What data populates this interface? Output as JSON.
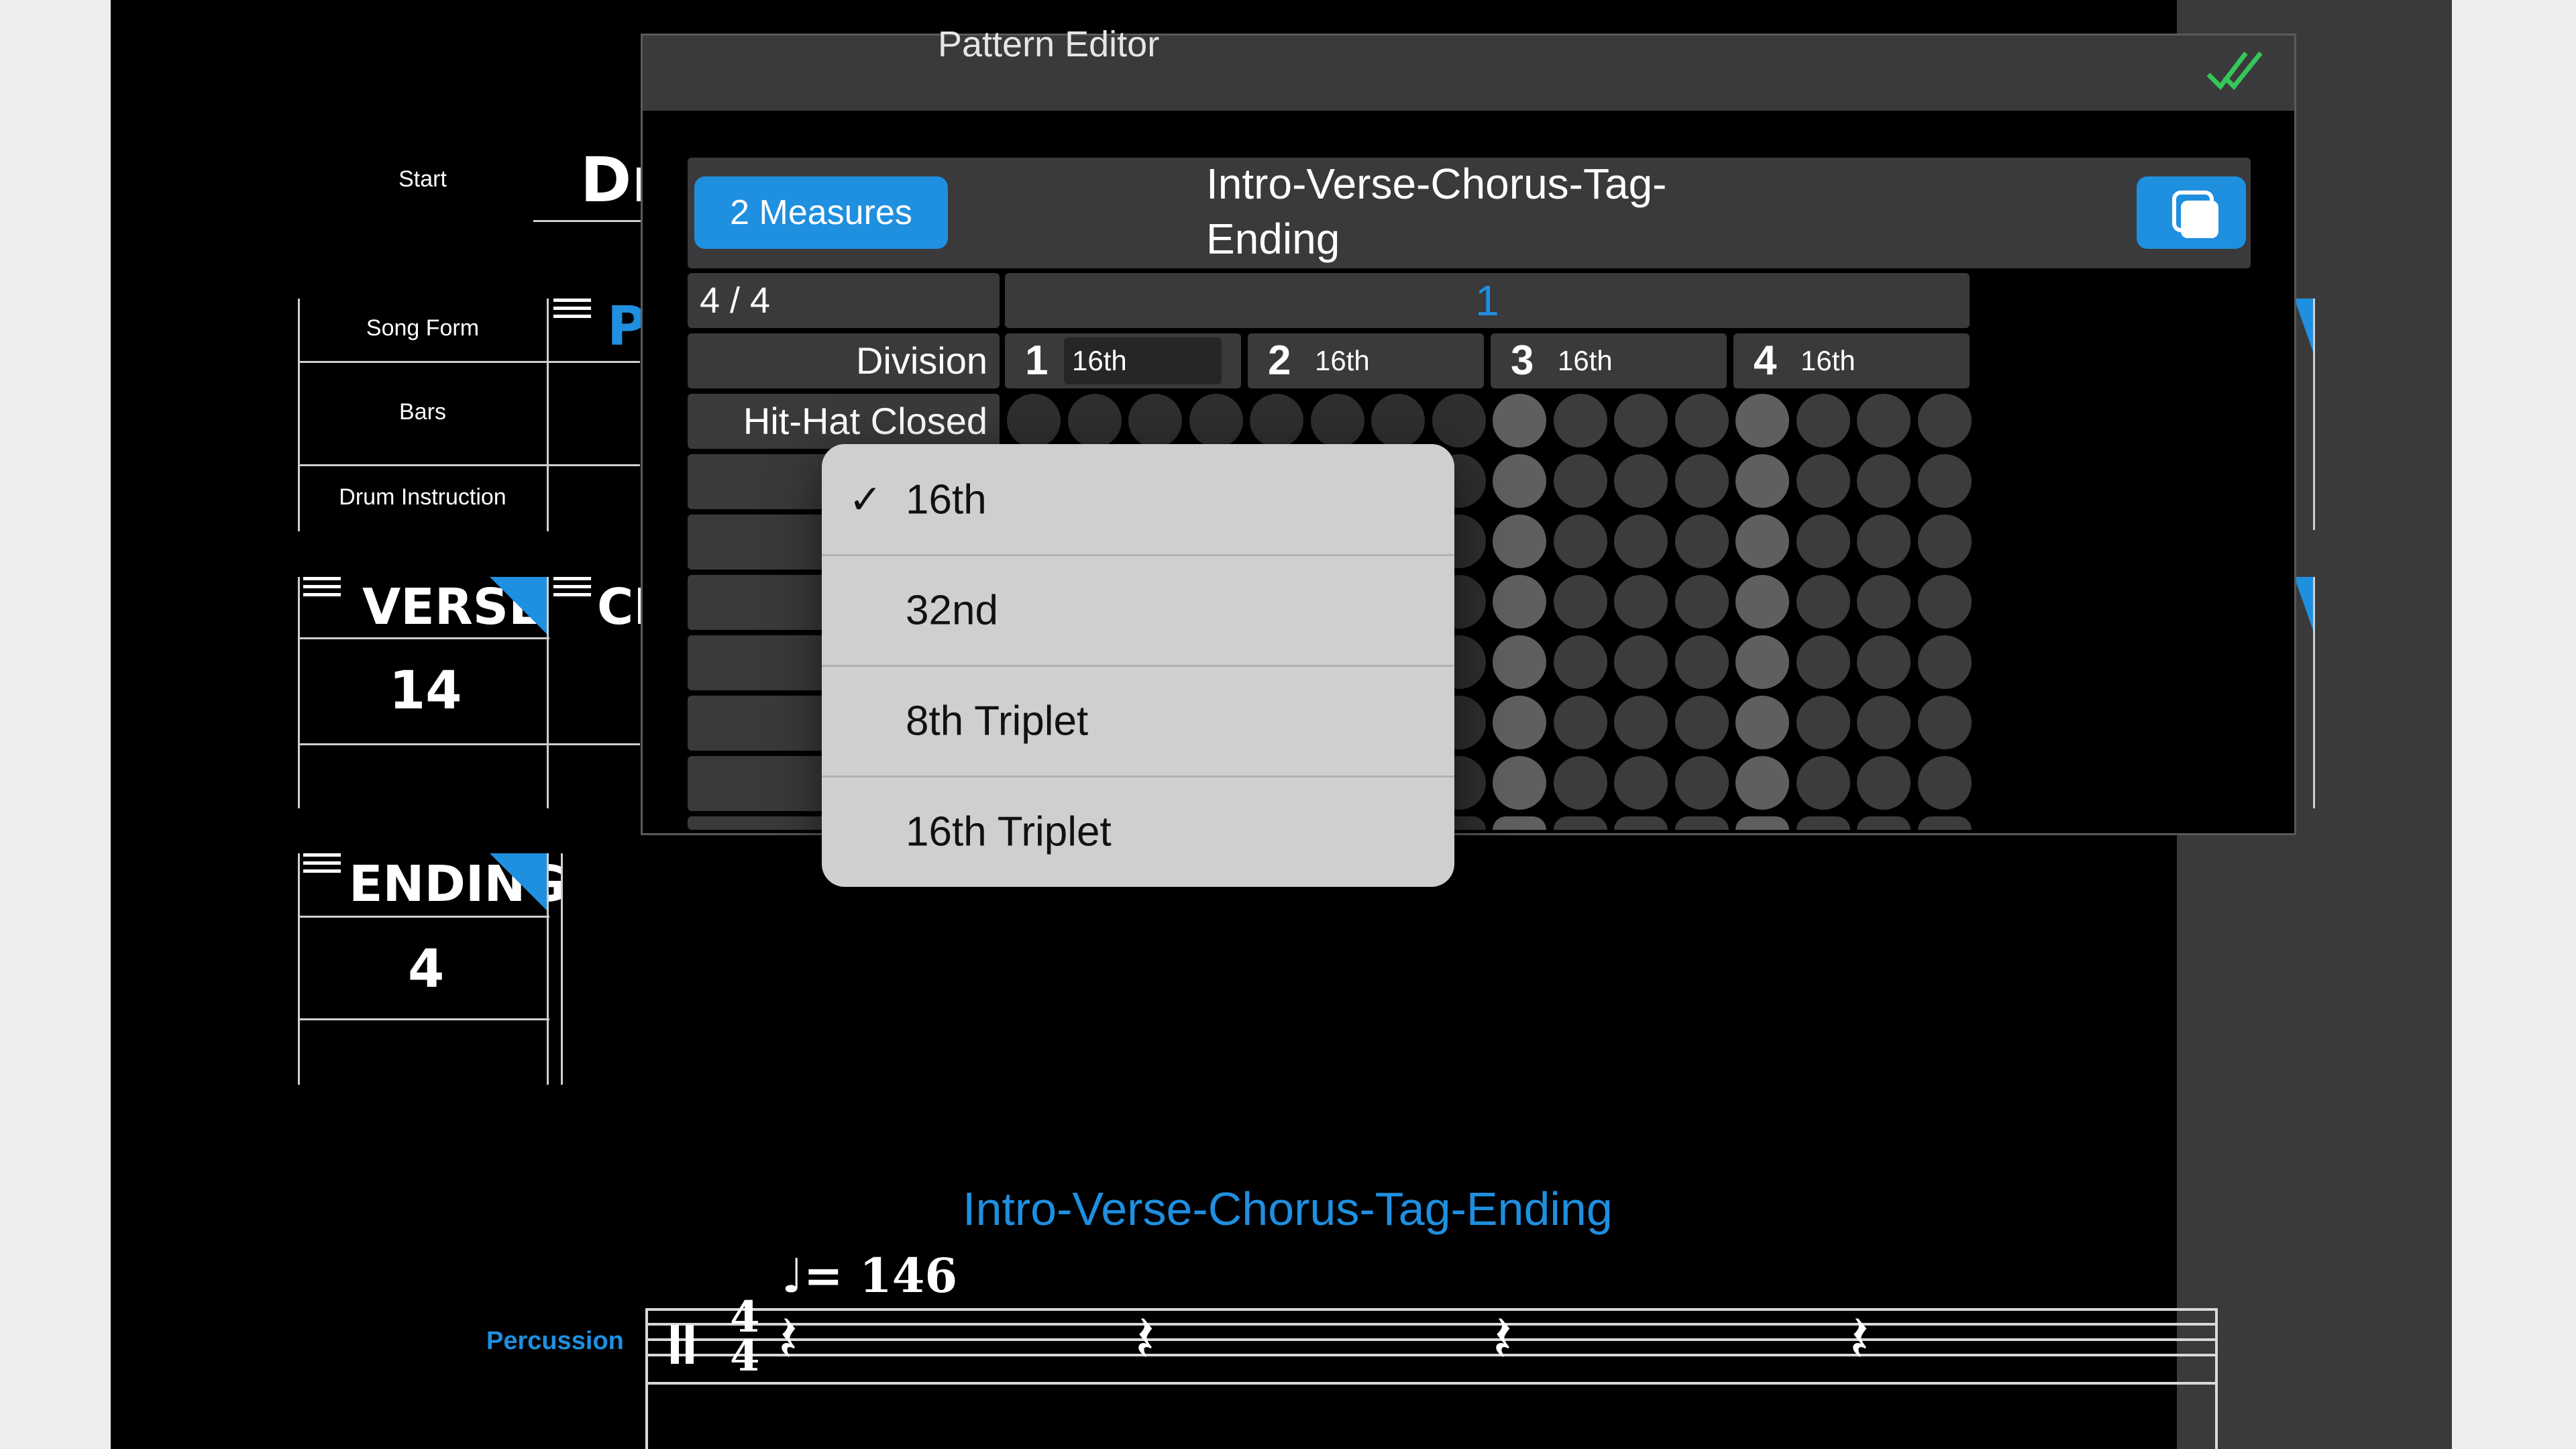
{
  "editor": {
    "title": "Pattern Editor",
    "measures_button": "2 Measures",
    "pattern_name_line1": "Intro-Verse-Chorus-Tag-",
    "pattern_name_line2": "Ending",
    "time_signature": "4 / 4",
    "measure_number": "1",
    "division_label": "Division",
    "beats": [
      {
        "num": "1",
        "division": "16th"
      },
      {
        "num": "2",
        "division": "16th"
      },
      {
        "num": "3",
        "division": "16th"
      },
      {
        "num": "4",
        "division": "16th"
      }
    ],
    "instrument_rows": [
      "Hit-Hat Closed",
      "",
      "",
      "",
      "Hit-",
      "",
      ""
    ]
  },
  "dropdown": {
    "options": [
      {
        "label": "16th",
        "checked": true
      },
      {
        "label": "32nd",
        "checked": false
      },
      {
        "label": "8th Triplet",
        "checked": false
      },
      {
        "label": "16th Triplet",
        "checked": false
      }
    ],
    "check_glyph": "✓"
  },
  "sheet": {
    "start_label": "Start",
    "song_form_label": "Song Form",
    "bars_label": "Bars",
    "drum_instruction_label": "Drum Instruction",
    "start_value_partial": "Dr",
    "song_form_partial": "P",
    "verse": {
      "title": "VERSE",
      "bars": "14"
    },
    "chorus_partial": "CH",
    "ending": {
      "title": "ENDING",
      "bars": "4"
    }
  },
  "score": {
    "title": "Intro-Verse-Chorus-Tag-Ending",
    "tempo": "= 146",
    "instrument": "Percussion",
    "time_sig_top": "4",
    "time_sig_bottom": "4"
  },
  "colors": {
    "accent_blue": "#1f8fe0",
    "check_green": "#34c759",
    "cell_gray": "#3a3a3c"
  }
}
